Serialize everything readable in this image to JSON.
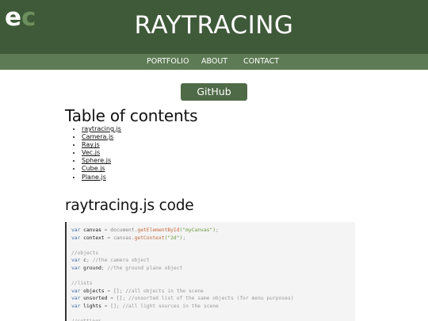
{
  "header": {
    "logo_text": "ec",
    "title": "RAYTRACING"
  },
  "nav": {
    "items": [
      "PORTFOLIO",
      "ABOUT",
      "CONTACT"
    ]
  },
  "github_button": {
    "label": "GitHub"
  },
  "toc": {
    "heading": "Table of contents",
    "items": [
      "raytracing.js",
      "Camera.js",
      "Ray.js",
      "Vec.js",
      "Sphere.js",
      "Cube.js",
      "Plane.js"
    ]
  },
  "code_section": {
    "heading": "raytracing.js code",
    "lines": [
      {
        "kw": "var",
        "name": "canvas",
        "rest": " = document.",
        "fn": "getElementById",
        "str": "(\"myCanvas\")",
        "end": ";"
      },
      {
        "kw": "var",
        "name": "context",
        "rest": " = canvas.",
        "fn": "getContext",
        "str": "(\"2d\")",
        "end": ";"
      },
      {
        "comment": "//objects"
      },
      {
        "kw": "var",
        "name": "c",
        "rest": "; ",
        "comment": "//the camera object"
      },
      {
        "kw": "var",
        "name": "ground",
        "rest": "; ",
        "comment": "//the ground plane object"
      },
      {
        "comment": "//lists"
      },
      {
        "kw": "var",
        "name": "objects",
        "rest": " = []; ",
        "comment": "//all objects in the scene"
      },
      {
        "kw": "var",
        "name": "unsorted",
        "rest": " = []; ",
        "comment": "//unsorted list of the same objects (for menu purposes)"
      },
      {
        "kw": "var",
        "name": "lights",
        "rest": " = []; ",
        "comment": "//all light sources in the scene"
      },
      {
        "comment": "//settings"
      }
    ]
  },
  "colors": {
    "header_bg": "#3f5a39",
    "nav_bg": "#5d7b54",
    "button_bg": "#4f6a47",
    "logo_e": "#ffffff",
    "logo_c": "#6d8f5e"
  }
}
